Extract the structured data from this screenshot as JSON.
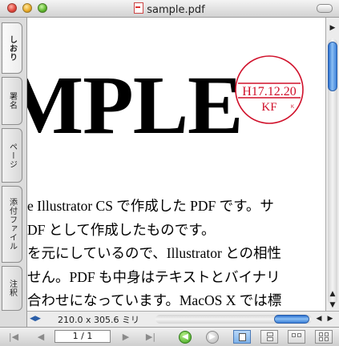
{
  "window": {
    "title": "sample.pdf"
  },
  "sidebar": {
    "tabs": [
      {
        "label": "しおり",
        "active": true
      },
      {
        "label": "署名",
        "active": false
      },
      {
        "label": "ページ",
        "active": false
      },
      {
        "label": "添付ファイル",
        "active": false
      },
      {
        "label": "注釈",
        "active": false
      }
    ]
  },
  "document": {
    "large_text": "MPLE",
    "lines": [
      "e Illustrator CS で作成した PDF です。サ",
      "DF として作成したものです。",
      "を元にしているので、Illustrator との相性",
      "せん。PDF も中身はテキストとバイナリ",
      "合わせになっています。MacOS X では標"
    ],
    "stamp": {
      "date": "H17.12.20",
      "initials": "KF",
      "mark": "K",
      "color": "#d0102a"
    }
  },
  "status": {
    "page_size": "210.0 x 305.6 ミリ"
  },
  "toolbar": {
    "page_field": "1 / 1"
  },
  "colors": {
    "scroll_thumb": "#3b7fd8",
    "nav_back": "#3aa018"
  }
}
